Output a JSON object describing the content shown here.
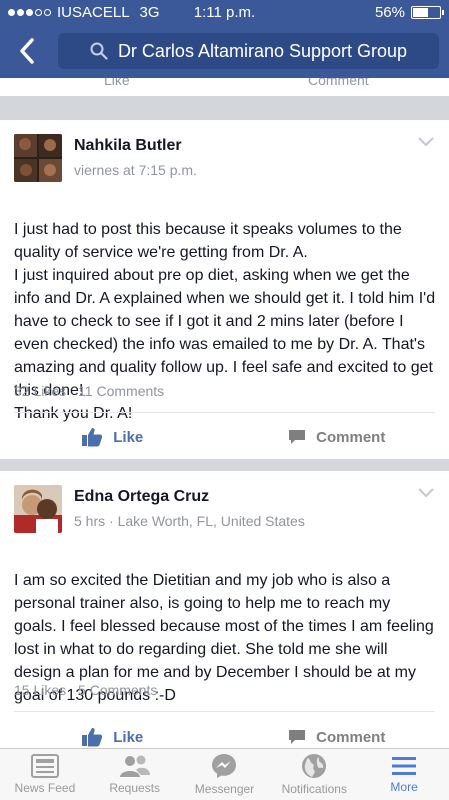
{
  "status_bar": {
    "carrier": "IUSACELL",
    "network": "3G",
    "time": "1:11 p.m.",
    "battery": "56%",
    "battery_level": 0.56
  },
  "header": {
    "search_text": "Dr Carlos Altamirano Support Group",
    "accent_color": "#3b5998"
  },
  "partial_card": {
    "like_label": "Like",
    "comment_label": "Comment"
  },
  "posts": [
    {
      "author": "Nahkila Butler",
      "meta": "viernes at 7:15 p.m.",
      "body": "I just had to post this because it speaks volumes to the quality of service we're getting from Dr. A.\nI just inquired about pre op diet, asking when we get the info and Dr. A explained when we should get it. I told him I'd have to check to see if I got it and 2 mins later (before I even checked) the info was emailed to me by Dr. A. That's amazing and quality follow up. I feel safe and excited to get this done!\nThank you Dr. A!",
      "likes": "32 Likes",
      "comments": "11 Comments",
      "like_label": "Like",
      "comment_label": "Comment"
    },
    {
      "author": "Edna Ortega Cruz",
      "meta": "5 hrs · Lake Worth, FL, United States",
      "body": "I am so excited the Dietitian and my job who is also a personal trainer also, is going to help me to reach my goals. I feel blessed because most of the times I am feeling lost in what to do regarding diet. She told me she will design a plan for me and by December I should be at my goal of 130 pounds :-D",
      "likes": "15 Likes",
      "comments": "5 Comments",
      "like_label": "Like",
      "comment_label": "Comment"
    }
  ],
  "tabs": [
    {
      "label": "News Feed",
      "icon": "news-feed-icon"
    },
    {
      "label": "Requests",
      "icon": "friend-requests-icon"
    },
    {
      "label": "Messenger",
      "icon": "messenger-icon"
    },
    {
      "label": "Notifications",
      "icon": "globe-icon"
    },
    {
      "label": "More",
      "icon": "menu-icon",
      "active": true
    }
  ]
}
